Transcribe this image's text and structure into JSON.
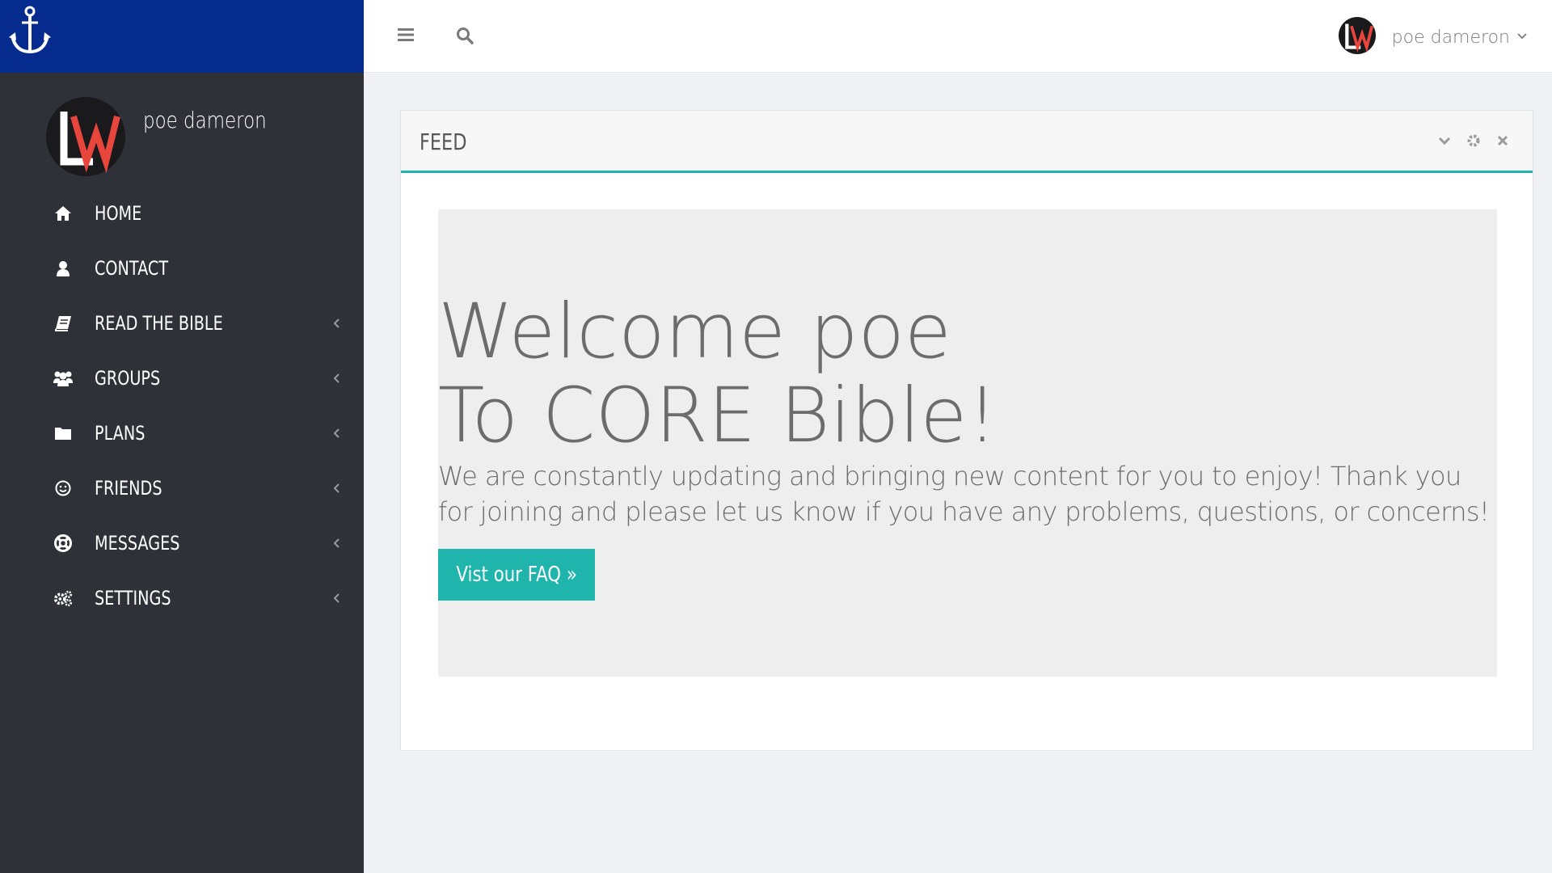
{
  "brand": {
    "logo_icon": "anchor-icon",
    "color": "#052b8f"
  },
  "profile": {
    "name": "poe dameron",
    "avatar_monogram": "LW"
  },
  "sidebar": {
    "items": [
      {
        "label": "HOME",
        "icon": "home-icon",
        "has_submenu": false
      },
      {
        "label": "CONTACT",
        "icon": "user-icon",
        "has_submenu": false
      },
      {
        "label": "READ THE BIBLE",
        "icon": "book-icon",
        "has_submenu": true
      },
      {
        "label": "GROUPS",
        "icon": "users-icon",
        "has_submenu": true
      },
      {
        "label": "PLANS",
        "icon": "folder-icon",
        "has_submenu": true
      },
      {
        "label": "FRIENDS",
        "icon": "smile-icon",
        "has_submenu": true
      },
      {
        "label": "MESSAGES",
        "icon": "life-ring-icon",
        "has_submenu": true
      },
      {
        "label": "SETTINGS",
        "icon": "cogs-icon",
        "has_submenu": true
      }
    ]
  },
  "topbar": {
    "menu_icon": "bars-icon",
    "search_icon": "search-icon",
    "user_name": "poe dameron"
  },
  "panel": {
    "title": "FEED",
    "tools": [
      "chevron-down-icon",
      "gear-icon",
      "close-icon"
    ],
    "accent_color": "#1fb5ad"
  },
  "welcome": {
    "title_line1": "Welcome poe",
    "title_line2": "To CORE Bible!",
    "text": "We are constantly updating and bringing new content for you to enjoy! Thank you for joining and please let us know if you have any problems, questions, or concerns!",
    "button_label": "Vist our FAQ »"
  }
}
